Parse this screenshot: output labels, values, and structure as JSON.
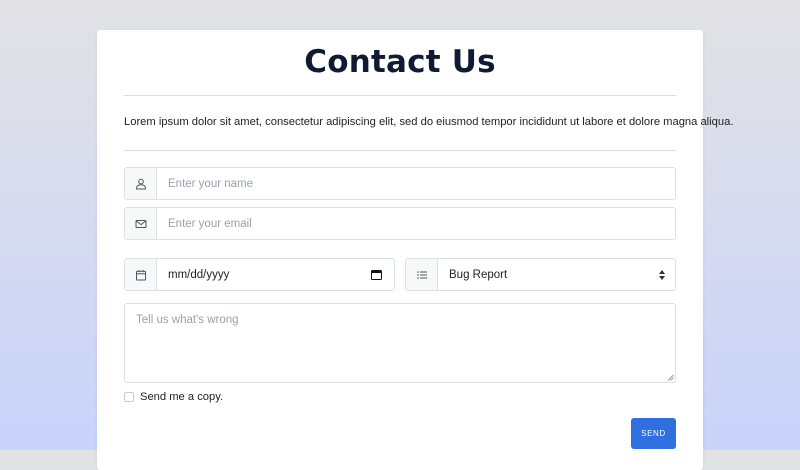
{
  "form": {
    "title": "Contact Us",
    "description": "Lorem ipsum dolor sit amet, consectetur adipiscing elit, sed do eiusmod tempor incididunt ut labore et dolore magna aliqua.",
    "name_placeholder": "Enter your name",
    "email_placeholder": "Enter your email",
    "date_value": "mm/dd/yyyy",
    "select_value": "Bug Report",
    "message_placeholder": "Tell us what's wrong",
    "copy_label": "Send me a copy.",
    "send_label": "SEND"
  },
  "icons": {
    "name": "user-icon",
    "email": "envelope-icon",
    "date": "calendar-icon",
    "select": "list-icon"
  },
  "colors": {
    "accent": "#2f6fe0",
    "title": "#0f1a33"
  }
}
